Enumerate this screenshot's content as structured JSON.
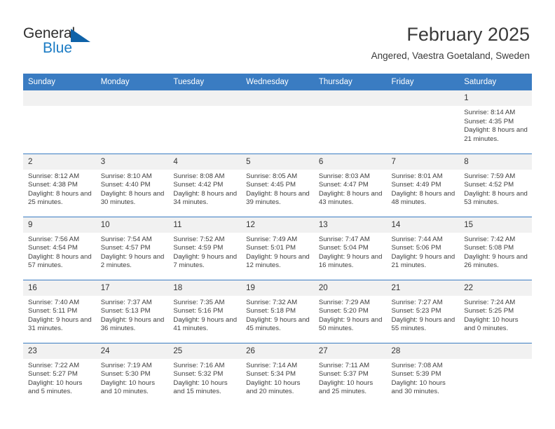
{
  "brand": {
    "name_part1": "General",
    "name_part2": "Blue",
    "triangle_icon": "blue-triangle-icon",
    "accent_color": "#1a7bc4"
  },
  "header": {
    "title": "February 2025",
    "location": "Angered, Vaestra Goetaland, Sweden"
  },
  "theme": {
    "header_blue": "#3a7cc2",
    "daynum_band": "#f1f1f1",
    "text": "#404040"
  },
  "weekdays": [
    "Sunday",
    "Monday",
    "Tuesday",
    "Wednesday",
    "Thursday",
    "Friday",
    "Saturday"
  ],
  "labels": {
    "sunrise": "Sunrise:",
    "sunset": "Sunset:",
    "daylight": "Daylight:"
  },
  "weeks": [
    [
      {
        "day": "",
        "blank": true
      },
      {
        "day": "",
        "blank": true
      },
      {
        "day": "",
        "blank": true
      },
      {
        "day": "",
        "blank": true
      },
      {
        "day": "",
        "blank": true
      },
      {
        "day": "",
        "blank": true
      },
      {
        "day": "1",
        "sunrise": "Sunrise: 8:14 AM",
        "sunset": "Sunset: 4:35 PM",
        "daylight": "Daylight: 8 hours and 21 minutes."
      }
    ],
    [
      {
        "day": "2",
        "sunrise": "Sunrise: 8:12 AM",
        "sunset": "Sunset: 4:38 PM",
        "daylight": "Daylight: 8 hours and 25 minutes."
      },
      {
        "day": "3",
        "sunrise": "Sunrise: 8:10 AM",
        "sunset": "Sunset: 4:40 PM",
        "daylight": "Daylight: 8 hours and 30 minutes."
      },
      {
        "day": "4",
        "sunrise": "Sunrise: 8:08 AM",
        "sunset": "Sunset: 4:42 PM",
        "daylight": "Daylight: 8 hours and 34 minutes."
      },
      {
        "day": "5",
        "sunrise": "Sunrise: 8:05 AM",
        "sunset": "Sunset: 4:45 PM",
        "daylight": "Daylight: 8 hours and 39 minutes."
      },
      {
        "day": "6",
        "sunrise": "Sunrise: 8:03 AM",
        "sunset": "Sunset: 4:47 PM",
        "daylight": "Daylight: 8 hours and 43 minutes."
      },
      {
        "day": "7",
        "sunrise": "Sunrise: 8:01 AM",
        "sunset": "Sunset: 4:49 PM",
        "daylight": "Daylight: 8 hours and 48 minutes."
      },
      {
        "day": "8",
        "sunrise": "Sunrise: 7:59 AM",
        "sunset": "Sunset: 4:52 PM",
        "daylight": "Daylight: 8 hours and 53 minutes."
      }
    ],
    [
      {
        "day": "9",
        "sunrise": "Sunrise: 7:56 AM",
        "sunset": "Sunset: 4:54 PM",
        "daylight": "Daylight: 8 hours and 57 minutes."
      },
      {
        "day": "10",
        "sunrise": "Sunrise: 7:54 AM",
        "sunset": "Sunset: 4:57 PM",
        "daylight": "Daylight: 9 hours and 2 minutes."
      },
      {
        "day": "11",
        "sunrise": "Sunrise: 7:52 AM",
        "sunset": "Sunset: 4:59 PM",
        "daylight": "Daylight: 9 hours and 7 minutes."
      },
      {
        "day": "12",
        "sunrise": "Sunrise: 7:49 AM",
        "sunset": "Sunset: 5:01 PM",
        "daylight": "Daylight: 9 hours and 12 minutes."
      },
      {
        "day": "13",
        "sunrise": "Sunrise: 7:47 AM",
        "sunset": "Sunset: 5:04 PM",
        "daylight": "Daylight: 9 hours and 16 minutes."
      },
      {
        "day": "14",
        "sunrise": "Sunrise: 7:44 AM",
        "sunset": "Sunset: 5:06 PM",
        "daylight": "Daylight: 9 hours and 21 minutes."
      },
      {
        "day": "15",
        "sunrise": "Sunrise: 7:42 AM",
        "sunset": "Sunset: 5:08 PM",
        "daylight": "Daylight: 9 hours and 26 minutes."
      }
    ],
    [
      {
        "day": "16",
        "sunrise": "Sunrise: 7:40 AM",
        "sunset": "Sunset: 5:11 PM",
        "daylight": "Daylight: 9 hours and 31 minutes."
      },
      {
        "day": "17",
        "sunrise": "Sunrise: 7:37 AM",
        "sunset": "Sunset: 5:13 PM",
        "daylight": "Daylight: 9 hours and 36 minutes."
      },
      {
        "day": "18",
        "sunrise": "Sunrise: 7:35 AM",
        "sunset": "Sunset: 5:16 PM",
        "daylight": "Daylight: 9 hours and 41 minutes."
      },
      {
        "day": "19",
        "sunrise": "Sunrise: 7:32 AM",
        "sunset": "Sunset: 5:18 PM",
        "daylight": "Daylight: 9 hours and 45 minutes."
      },
      {
        "day": "20",
        "sunrise": "Sunrise: 7:29 AM",
        "sunset": "Sunset: 5:20 PM",
        "daylight": "Daylight: 9 hours and 50 minutes."
      },
      {
        "day": "21",
        "sunrise": "Sunrise: 7:27 AM",
        "sunset": "Sunset: 5:23 PM",
        "daylight": "Daylight: 9 hours and 55 minutes."
      },
      {
        "day": "22",
        "sunrise": "Sunrise: 7:24 AM",
        "sunset": "Sunset: 5:25 PM",
        "daylight": "Daylight: 10 hours and 0 minutes."
      }
    ],
    [
      {
        "day": "23",
        "sunrise": "Sunrise: 7:22 AM",
        "sunset": "Sunset: 5:27 PM",
        "daylight": "Daylight: 10 hours and 5 minutes."
      },
      {
        "day": "24",
        "sunrise": "Sunrise: 7:19 AM",
        "sunset": "Sunset: 5:30 PM",
        "daylight": "Daylight: 10 hours and 10 minutes."
      },
      {
        "day": "25",
        "sunrise": "Sunrise: 7:16 AM",
        "sunset": "Sunset: 5:32 PM",
        "daylight": "Daylight: 10 hours and 15 minutes."
      },
      {
        "day": "26",
        "sunrise": "Sunrise: 7:14 AM",
        "sunset": "Sunset: 5:34 PM",
        "daylight": "Daylight: 10 hours and 20 minutes."
      },
      {
        "day": "27",
        "sunrise": "Sunrise: 7:11 AM",
        "sunset": "Sunset: 5:37 PM",
        "daylight": "Daylight: 10 hours and 25 minutes."
      },
      {
        "day": "28",
        "sunrise": "Sunrise: 7:08 AM",
        "sunset": "Sunset: 5:39 PM",
        "daylight": "Daylight: 10 hours and 30 minutes."
      },
      {
        "day": "",
        "blank": true
      }
    ]
  ]
}
